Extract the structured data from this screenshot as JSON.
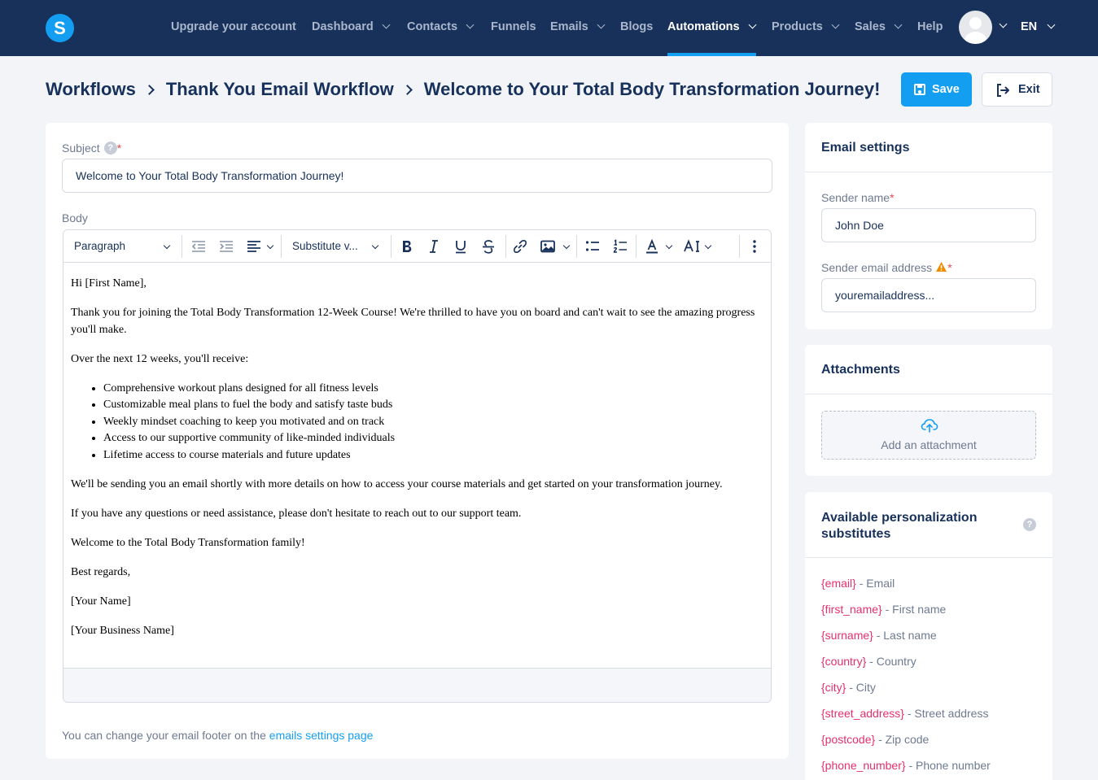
{
  "nav": {
    "logo": "S",
    "items": [
      {
        "label": "Upgrade your account",
        "dropdown": false,
        "active": false
      },
      {
        "label": "Dashboard",
        "dropdown": true,
        "active": false
      },
      {
        "label": "Contacts",
        "dropdown": true,
        "active": false
      },
      {
        "label": "Funnels",
        "dropdown": false,
        "active": false
      },
      {
        "label": "Emails",
        "dropdown": true,
        "active": false
      },
      {
        "label": "Blogs",
        "dropdown": false,
        "active": false
      },
      {
        "label": "Automations",
        "dropdown": true,
        "active": true
      },
      {
        "label": "Products",
        "dropdown": true,
        "active": false
      },
      {
        "label": "Sales",
        "dropdown": true,
        "active": false
      },
      {
        "label": "Help",
        "dropdown": false,
        "active": false
      }
    ],
    "language": "EN"
  },
  "breadcrumb": [
    "Workflows",
    "Thank You Email Workflow",
    "Welcome to Your Total Body Transformation Journey!"
  ],
  "actions": {
    "save": "Save",
    "exit": "Exit"
  },
  "form": {
    "subject_label": "Subject",
    "subject_help": "?",
    "required_mark": "*",
    "subject_value": "Welcome to Your Total Body Transformation Journey!",
    "body_label": "Body",
    "toolbar": {
      "block_format": "Paragraph",
      "substitute": "Substitute v..."
    },
    "body": {
      "greeting": "Hi [First Name],",
      "intro": "Thank you for joining the Total Body Transformation 12-Week Course! We're thrilled to have you on board and can't wait to see the amazing progress you'll make.",
      "list_intro": "Over the next 12 weeks, you'll receive:",
      "list": [
        "Comprehensive workout plans designed for all fitness levels",
        "Customizable meal plans to fuel the body and satisfy taste buds",
        "Weekly mindset coaching to keep you motivated and on track",
        "Access to our supportive community of like-minded individuals",
        "Lifetime access to course materials and future updates"
      ],
      "followup": "We'll be sending you an email shortly with more details on how to access your course materials and get started on your transformation journey.",
      "questions": "If you have any questions or need assistance, please don't hesitate to reach out to our support team.",
      "welcome": "Welcome to the Total Body Transformation family!",
      "closing": "Best regards,",
      "name": "[Your Name]",
      "business": "[Your Business Name]"
    },
    "footer_text": "You can change your email footer on the",
    "footer_link": "emails settings page"
  },
  "email_settings": {
    "title": "Email settings",
    "sender_name_label": "Sender name",
    "sender_name_value": "John Doe",
    "sender_email_label": "Sender email address",
    "sender_email_value": "youremailaddress..."
  },
  "attachments": {
    "title": "Attachments",
    "add_label": "Add an attachment"
  },
  "substitutes": {
    "title": "Available personalization substitutes",
    "help": "?",
    "items": [
      {
        "tag": "{email}",
        "desc": "- Email"
      },
      {
        "tag": "{first_name}",
        "desc": "- First name"
      },
      {
        "tag": "{surname}",
        "desc": "- Last name"
      },
      {
        "tag": "{country}",
        "desc": "- Country"
      },
      {
        "tag": "{city}",
        "desc": "- City"
      },
      {
        "tag": "{street_address}",
        "desc": "- Street address"
      },
      {
        "tag": "{postcode}",
        "desc": "- Zip code"
      },
      {
        "tag": "{phone_number}",
        "desc": "- Phone number"
      }
    ]
  },
  "colors": {
    "nav_bg": "#17315b",
    "accent": "#149ef2",
    "tag": "#e5306b",
    "warning": "#f08c00"
  }
}
